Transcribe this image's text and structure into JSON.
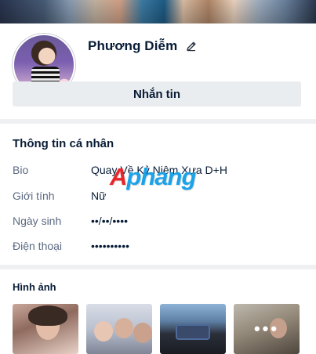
{
  "profile": {
    "name": "Phương Diễm",
    "avatar_icon": "avatar-photo",
    "edit_icon": "pencil-icon"
  },
  "actions": {
    "message_label": "Nhắn tin"
  },
  "personal_info": {
    "title": "Thông tin cá nhân",
    "rows": [
      {
        "label": "Bio",
        "value": "Quay Về Kỷ Niệm Xưa  D+H"
      },
      {
        "label": "Giới tính",
        "value": "Nữ"
      },
      {
        "label": "Ngày sinh",
        "value": "••/••/••••"
      },
      {
        "label": "Điện thoại",
        "value": "••••••••••"
      }
    ]
  },
  "watermark": {
    "part1": "A",
    "part2": "phang"
  },
  "photos": {
    "title": "Hình ảnh",
    "more_label": "•••"
  },
  "colors": {
    "text_primary": "#081c36",
    "text_secondary": "#5a6981",
    "button_bg": "#eaedf0",
    "divider": "#eef0f1"
  }
}
